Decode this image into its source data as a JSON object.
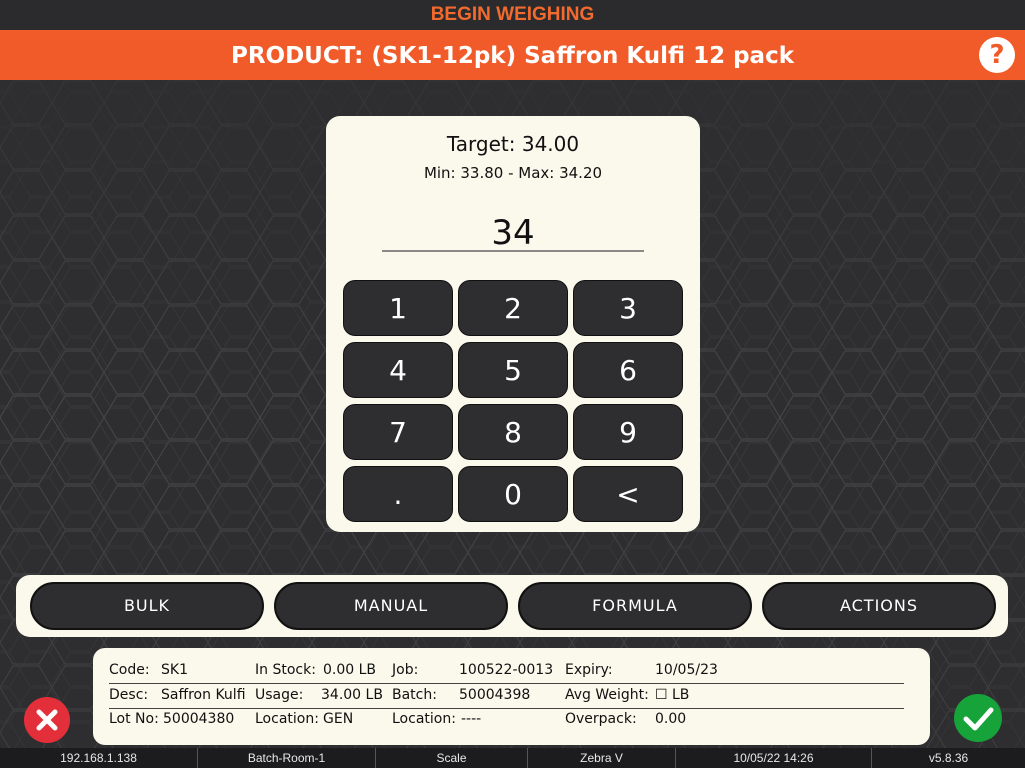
{
  "header": {
    "title": "BEGIN WEIGHING",
    "product_label": "PRODUCT: (SK1-12pk) Saffron Kulfi 12 pack",
    "help_label": "?"
  },
  "keypad": {
    "target": "Target: 34.00",
    "range": "Min: 33.80 - Max: 34.20",
    "value": "34",
    "keys": [
      "1",
      "2",
      "3",
      "4",
      "5",
      "6",
      "7",
      "8",
      "9",
      ".",
      "0",
      "<"
    ]
  },
  "actions": [
    "BULK",
    "MANUAL",
    "FORMULA",
    "ACTIONS"
  ],
  "info": {
    "code_label": "Code:",
    "code": "SK1",
    "desc_label": "Desc:",
    "desc": "Saffron Kulfi",
    "lot_label": "Lot No:",
    "lot": "50004380",
    "stock_label": "In Stock:",
    "stock": "0.00 LB",
    "usage_label": "Usage:",
    "usage": "34.00 LB",
    "location_label": "Location:",
    "location": "GEN",
    "job_label": "Job:",
    "job": "100522-0013",
    "batch_label": "Batch:",
    "batch": "50004398",
    "location2_label": "Location:",
    "location2": "----",
    "expiry_label": "Expiry:",
    "expiry": "10/05/23",
    "avgweight_label": "Avg Weight:",
    "avgweight": "☐ LB",
    "overpack_label": "Overpack:",
    "overpack": "0.00"
  },
  "status": {
    "ip": "192.168.1.138",
    "room": "Batch-Room-1",
    "device": "Scale",
    "printer": "Zebra V",
    "datetime": "10/05/22 14:26",
    "version": "v5.8.36"
  },
  "colors": {
    "accent": "#f15a29",
    "background": "#2e2e30",
    "panel": "#fbf8ec",
    "cancel": "#e32f3a",
    "confirm": "#16a33a"
  },
  "icons": {
    "help": "question-icon",
    "cancel": "close-icon",
    "confirm": "check-icon"
  }
}
